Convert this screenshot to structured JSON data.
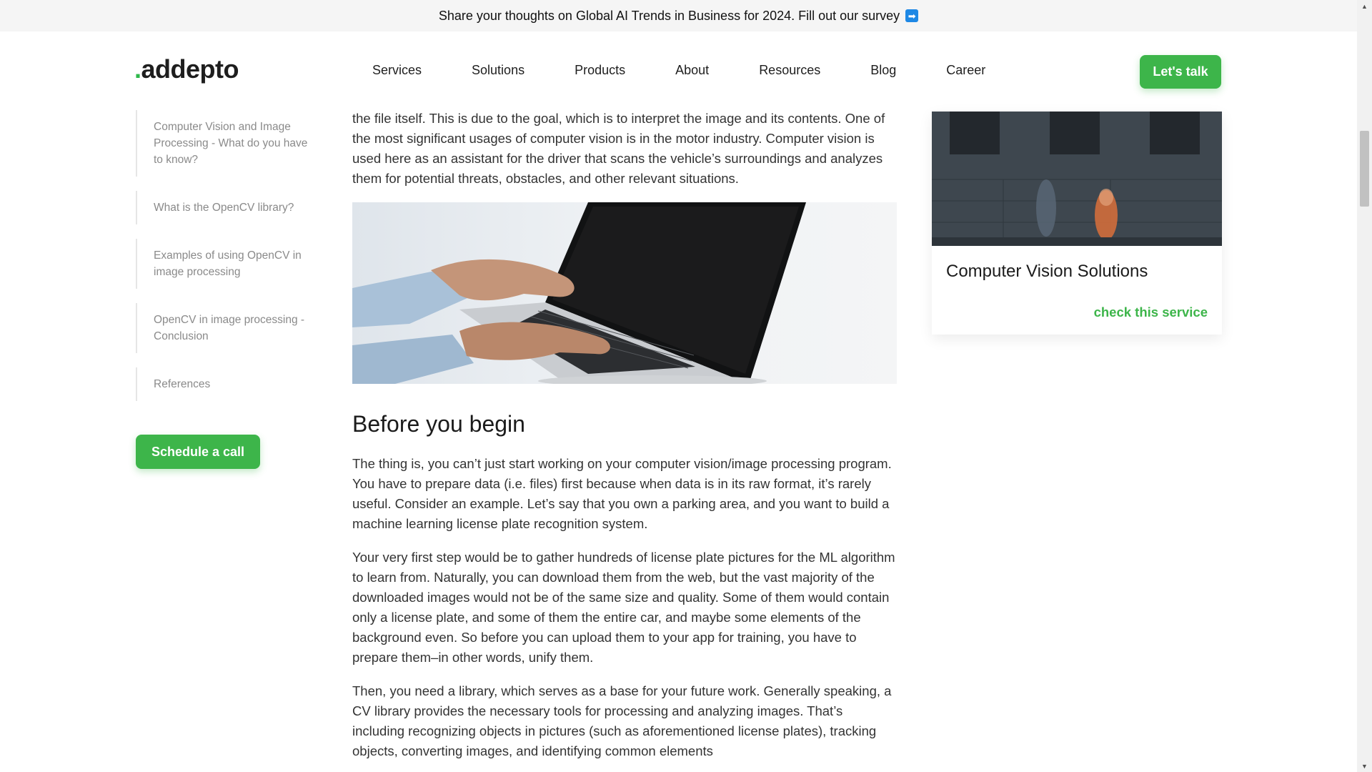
{
  "banner": {
    "text": "Share your thoughts on Global AI Trends in Business for 2024. Fill out our survey",
    "icon": "arrow-right-icon"
  },
  "header": {
    "logo_dot": ".",
    "logo_text": "addepto",
    "nav": [
      "Services",
      "Solutions",
      "Products",
      "About",
      "Resources",
      "Blog",
      "Career"
    ],
    "cta": "Let's talk"
  },
  "toc": {
    "items": [
      "Computer Vision and Image Processing - What do you have to know?",
      "What is the OpenCV library?",
      "Examples of using OpenCV in image processing",
      "OpenCV in image processing - Conclusion",
      "References"
    ],
    "schedule_label": "Schedule a call"
  },
  "article": {
    "intro": "the file itself. This is due to the goal, which is to interpret the image and its contents. One of the most significant usages of computer vision is in the motor industry. Computer vision is used here as an assistant for the driver that scans the vehicle’s surroundings and analyzes them for potential threats, obstacles, and other relevant situations.",
    "heading": "Before you begin",
    "p1": "The thing is, you can’t just start working on your computer vision/image processing program. You have to prepare data (i.e. files) first because when data is in its raw format, it’s rarely useful. Consider an example. Let’s say that you own a parking area, and you want to build a machine learning license plate recognition system.",
    "p2": "Your very first step would be to gather hundreds of license plate pictures for the ML algorithm to learn from. Naturally, you can download them from the web, but the vast majority of the downloaded images would not be of the same size and quality. Some of them would contain only a license plate, and some of them the entire car, and maybe some elements of the background even. So before you can upload them to your app for training, you have to prepare them–in other words, unify them.",
    "p3": "Then, you need a library, which serves as a base for your future work. Generally speaking, a CV library provides the necessary tools for processing and analyzing images. That’s including recognizing objects in pictures (such as aforementioned license plates), tracking objects, converting images, and identifying common elements"
  },
  "service_card": {
    "title": "Computer Vision Solutions",
    "link": "check this service"
  },
  "colors": {
    "accent": "#3db54a",
    "banner_bg": "#f5f5f5",
    "link_blue": "#1e88e5"
  }
}
